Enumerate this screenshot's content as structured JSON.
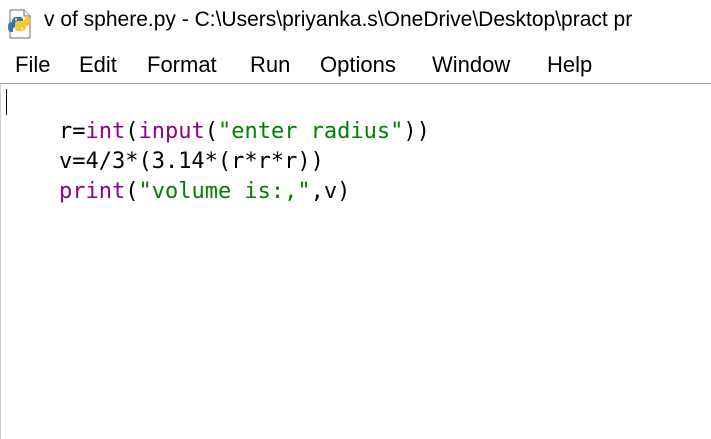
{
  "window": {
    "title": "v of sphere.py - C:\\Users\\priyanka.s\\OneDrive\\Desktop\\pract pr"
  },
  "menu": {
    "items": [
      "File",
      "Edit",
      "Format",
      "Run",
      "Options",
      "Window",
      "Help"
    ]
  },
  "editor": {
    "lines": [
      {
        "tokens": [
          {
            "text": "r=",
            "kind": "plain"
          },
          {
            "text": "int",
            "kind": "kw"
          },
          {
            "text": "(",
            "kind": "plain"
          },
          {
            "text": "input",
            "kind": "kw"
          },
          {
            "text": "(",
            "kind": "plain"
          },
          {
            "text": "\"enter radius\"",
            "kind": "str"
          },
          {
            "text": "))",
            "kind": "plain"
          }
        ]
      },
      {
        "tokens": [
          {
            "text": "v=4/3*(3.14*(r*r*r))",
            "kind": "plain"
          }
        ]
      },
      {
        "tokens": [
          {
            "text": "print",
            "kind": "kw"
          },
          {
            "text": "(",
            "kind": "plain"
          },
          {
            "text": "\"volume is:,\"",
            "kind": "str"
          },
          {
            "text": ",v)",
            "kind": "plain"
          }
        ]
      }
    ]
  },
  "colors": {
    "keyword": "#900090",
    "string": "#008000",
    "text": "#000000",
    "background": "#ffffff"
  },
  "icons": {
    "app": "python-icon"
  }
}
